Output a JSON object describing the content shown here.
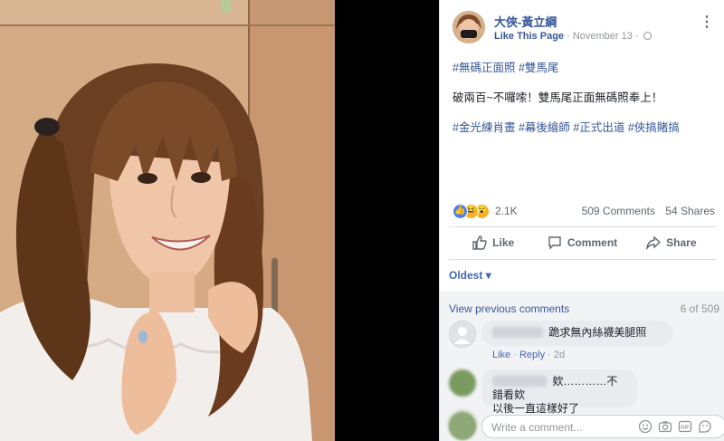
{
  "photo": {
    "alt_icon": "portrait-photo"
  },
  "post": {
    "page_name": "大俠-黃立綱",
    "like_page": "Like This Page",
    "separator": "·",
    "date": "November 13",
    "separator2": "·",
    "line1": [
      "#無碼正面照",
      "#雙馬尾"
    ],
    "line2": "破兩百~不囉嗦！雙馬尾正面無碼照奉上！",
    "line3": [
      "#金光練肖畫",
      "#幕後繪師",
      "#正式出道",
      "#俠搞賭搞"
    ]
  },
  "reactions": {
    "icons": [
      "like-reaction-icon",
      "haha-reaction-icon",
      "wow-reaction-icon"
    ],
    "count": "2.1K",
    "comments": "509 Comments",
    "shares": "54 Shares"
  },
  "actions": {
    "like": "Like",
    "comment": "Comment",
    "share": "Share"
  },
  "sort": {
    "label": "Oldest",
    "arrow": "▾"
  },
  "comments": {
    "view_previous": "View previous comments",
    "count_of": "6 of 509",
    "items": [
      {
        "text": "跪求無內絲襪美腿照",
        "like": "Like",
        "reply": "Reply",
        "dot": "·",
        "time": "2d"
      },
      {
        "text1": "欸…………不錯看欸",
        "text2": "以後一直這樣好了"
      }
    ],
    "write_placeholder": "Write a comment..."
  },
  "colors": {
    "link": "#365899",
    "accent": "#4267b2",
    "like_blue": "#4a80f5",
    "haha_yellow": "#f7b125"
  }
}
